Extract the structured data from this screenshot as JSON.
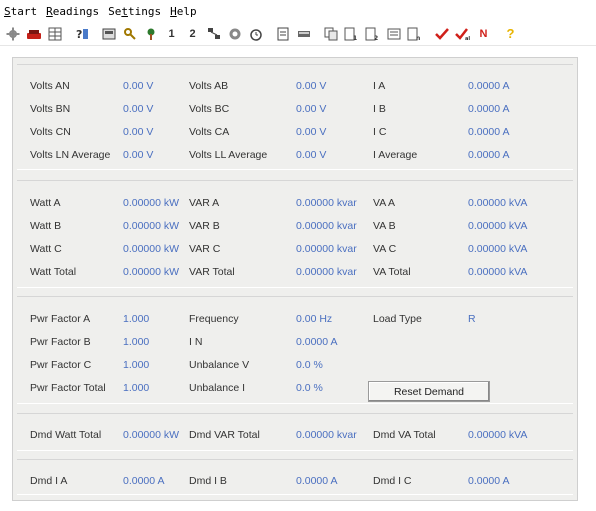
{
  "menu": [
    {
      "first": "S",
      "rest": "tart"
    },
    {
      "first": "R",
      "rest": "eadings"
    },
    {
      "first": "S",
      "rest": "ettings"
    },
    {
      "first": "H",
      "rest": "elp"
    }
  ],
  "toolbar": {
    "icons": [
      "settings-icon",
      "connect-icon",
      "grid-icon",
      "help-icon",
      "display-icon",
      "key-icon",
      "tool-icon",
      "one-label",
      "two-label",
      "network-icon",
      "record-icon",
      "alarm-icon",
      "page-icon",
      "monitor-icon",
      "copy-icon",
      "document-1-icon",
      "document-2-icon",
      "event-icon",
      "document-n-icon",
      "check-icon",
      "check-all-icon",
      "n-label",
      "question-icon"
    ],
    "text_one": "1",
    "text_two": "2",
    "text_n": "N",
    "text_q": "?"
  },
  "volts": {
    "rows": [
      {
        "l1": "Volts AN",
        "v1": "0.00 V",
        "l2": "Volts AB",
        "v2": "0.00 V",
        "l3": "I A",
        "v3": "0.0000 A"
      },
      {
        "l1": "Volts BN",
        "v1": "0.00 V",
        "l2": "Volts BC",
        "v2": "0.00 V",
        "l3": "I B",
        "v3": "0.0000 A"
      },
      {
        "l1": "Volts CN",
        "v1": "0.00 V",
        "l2": "Volts CA",
        "v2": "0.00 V",
        "l3": "I C",
        "v3": "0.0000 A"
      },
      {
        "l1": "Volts LN Average",
        "v1": "0.00 V",
        "l2": "Volts LL Average",
        "v2": "0.00 V",
        "l3": "I Average",
        "v3": "0.0000 A"
      }
    ]
  },
  "power": {
    "rows": [
      {
        "l1": "Watt A",
        "v1": "0.00000 kW",
        "l2": "VAR A",
        "v2": "0.00000 kvar",
        "l3": "VA A",
        "v3": "0.00000 kVA"
      },
      {
        "l1": "Watt B",
        "v1": "0.00000 kW",
        "l2": "VAR B",
        "v2": "0.00000 kvar",
        "l3": "VA B",
        "v3": "0.00000 kVA"
      },
      {
        "l1": "Watt C",
        "v1": "0.00000 kW",
        "l2": "VAR C",
        "v2": "0.00000 kvar",
        "l3": "VA C",
        "v3": "0.00000 kVA"
      },
      {
        "l1": "Watt Total",
        "v1": "0.00000 kW",
        "l2": "VAR Total",
        "v2": "0.00000 kvar",
        "l3": "VA Total",
        "v3": "0.00000 kVA"
      }
    ]
  },
  "pf": {
    "rows": [
      {
        "l1": "Pwr Factor A",
        "v1": "1.000",
        "l2": "Frequency",
        "v2": "0.00 Hz",
        "l3": "Load Type",
        "v3": "R"
      },
      {
        "l1": "Pwr Factor B",
        "v1": "1.000",
        "l2": "I N",
        "v2": "0.0000 A"
      },
      {
        "l1": "Pwr Factor C",
        "v1": "1.000",
        "l2": "Unbalance V",
        "v2": "0.0 %"
      },
      {
        "l1": "Pwr Factor Total",
        "v1": "1.000",
        "l2": "Unbalance I",
        "v2": "0.0 %"
      }
    ],
    "reset_label": "Reset Demand"
  },
  "demand": {
    "l1": "Dmd Watt Total",
    "v1": "0.00000 kW",
    "l2": "Dmd VAR Total",
    "v2": "0.00000 kvar",
    "l3": "Dmd VA Total",
    "v3": "0.00000 kVA"
  },
  "demand_current": {
    "l1": "Dmd I A",
    "v1": "0.0000 A",
    "l2": "Dmd I B",
    "v2": "0.0000 A",
    "l3": "Dmd I C",
    "v3": "0.0000 A"
  },
  "colors": {
    "value": "#4a6fc0",
    "panel": "#efefed",
    "check": "#d0201a",
    "question": "#e8b400"
  }
}
